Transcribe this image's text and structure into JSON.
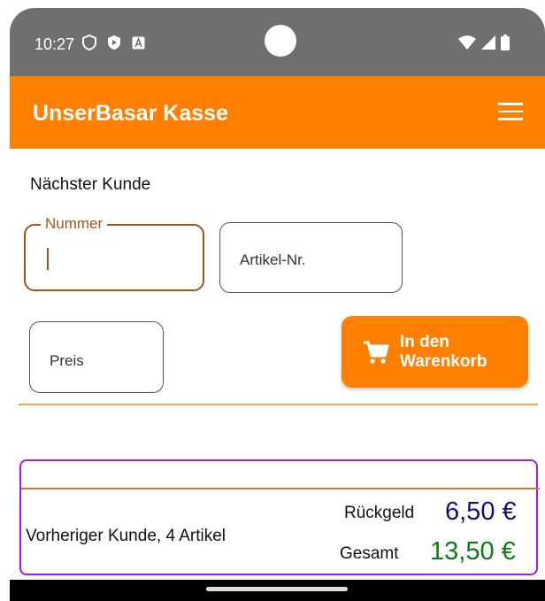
{
  "status": {
    "time": "10:27"
  },
  "app": {
    "title": "UnserBasar Kasse"
  },
  "next_customer_label": "Nächster Kunde",
  "fields": {
    "number_label": "Nummer",
    "article_placeholder": "Artikel-Nr.",
    "price_placeholder": "Preis"
  },
  "cart_button": {
    "label": "In den\nWarenkorb"
  },
  "previous": {
    "label": "Vorheriger Kunde, 4 Artikel",
    "change_label": "Rückgeld",
    "change_value": "6,50 €",
    "total_label": "Gesamt",
    "total_value": "13,50 €"
  },
  "colors": {
    "accent": "#ff8000",
    "focus": "#a2551b",
    "change": "#10107a",
    "total": "#0a7e14",
    "highlight_border": "#a31ee0"
  },
  "icons": [
    "shield-icon",
    "play-shield-icon",
    "font-icon",
    "wifi-icon",
    "signal-icon",
    "battery-icon",
    "menu-icon",
    "cart-icon"
  ]
}
